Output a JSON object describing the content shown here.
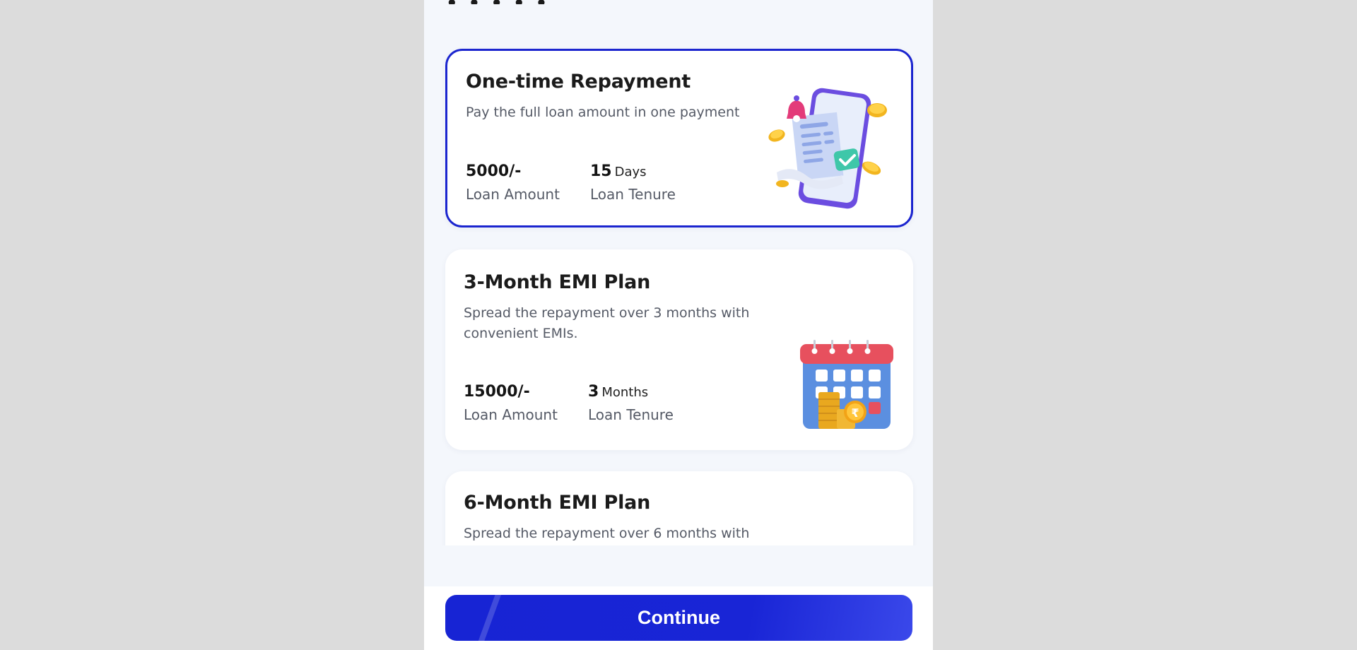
{
  "plans": [
    {
      "title": "One-time Repayment",
      "description": "Pay the full loan amount in one payment",
      "amount": "5000/-",
      "amount_label": "Loan Amount",
      "tenure_value": "15",
      "tenure_unit": "Days",
      "tenure_label": "Loan Tenure",
      "illustration": "phone-bill-coins-icon",
      "selected": true
    },
    {
      "title": "3-Month EMI Plan",
      "description": "Spread the repayment over 3 months with convenient EMIs.",
      "amount": "15000/-",
      "amount_label": "Loan Amount",
      "tenure_value": "3",
      "tenure_unit": "Months",
      "tenure_label": "Loan Tenure",
      "illustration": "calendar-coins-icon",
      "selected": false
    },
    {
      "title": "6-Month EMI Plan",
      "description": "Spread the repayment over 6 months with",
      "selected": false
    }
  ],
  "footer": {
    "continue_label": "Continue"
  },
  "colors": {
    "accent": "#1b25cf",
    "background": "#f4f7fc",
    "outer_background": "#dcdcdc"
  }
}
